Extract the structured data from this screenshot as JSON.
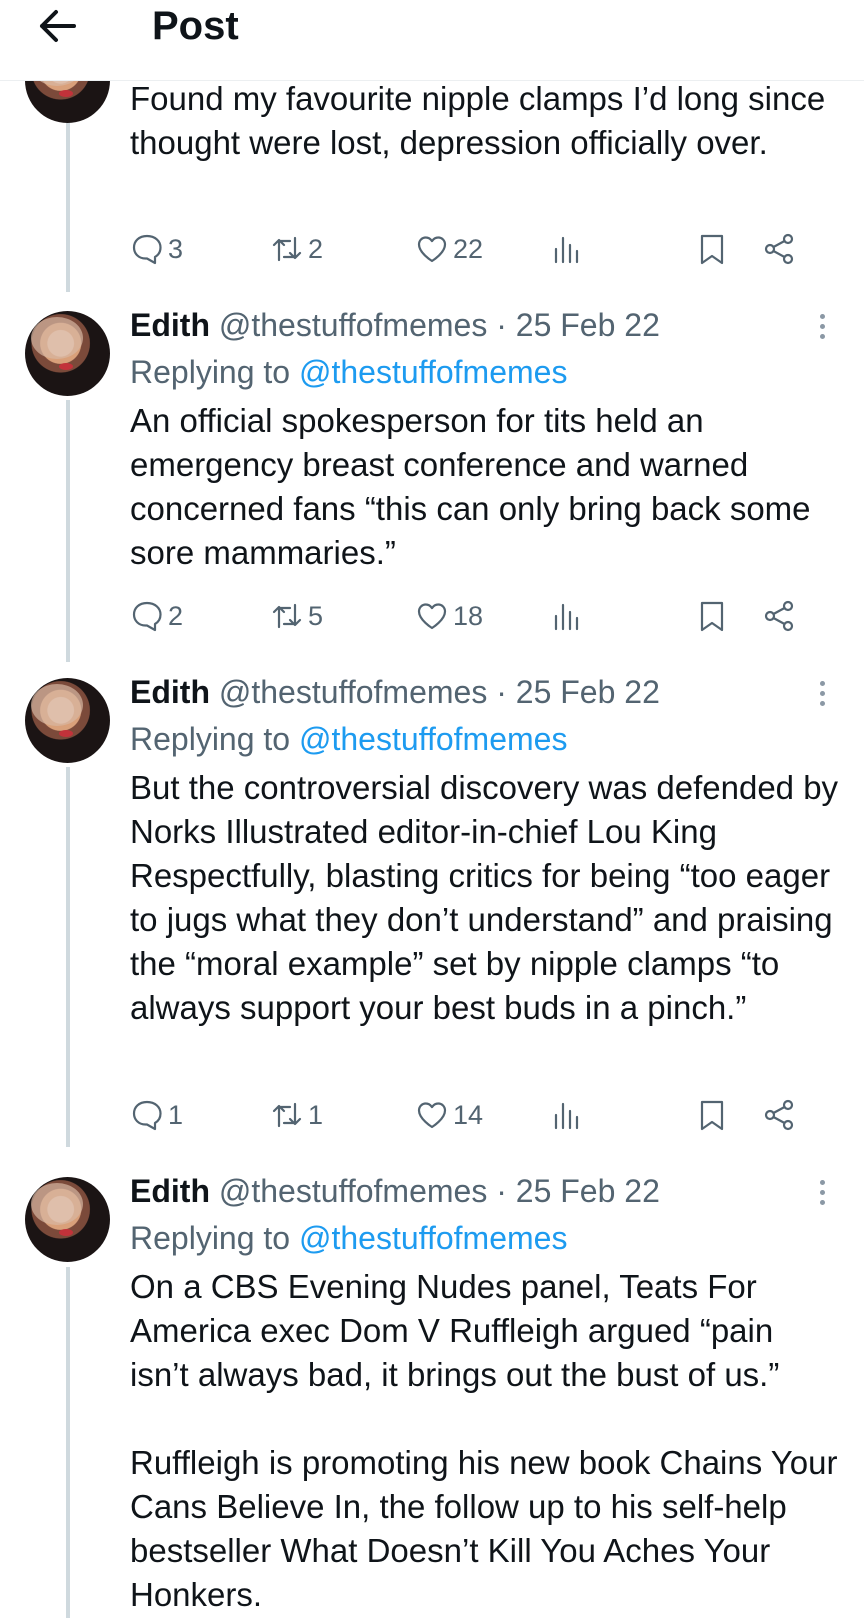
{
  "header": {
    "title": "Post",
    "back_icon": "arrow-left-icon"
  },
  "tweets": [
    {
      "text": "Found my favourite nipple clamps I’d long since thought were lost, depression officially over.",
      "replies": "3",
      "reposts": "2",
      "likes": "22"
    },
    {
      "name": "Edith",
      "handle": "@thestuffofmemes",
      "sep": "·",
      "date": "25 Feb 22",
      "replying_prefix": "Replying to",
      "replying_to": "@thestuffofmemes",
      "text": "An official spokesperson for tits held an emergency breast conference and warned concerned fans “this can only bring back some sore mammaries.”",
      "replies": "2",
      "reposts": "5",
      "likes": "18"
    },
    {
      "name": "Edith",
      "handle": "@thestuffofmemes",
      "sep": "·",
      "date": "25 Feb 22",
      "replying_prefix": "Replying to",
      "replying_to": "@thestuffofmemes",
      "text": "But the controversial discovery was defended by Norks Illustrated editor-in-chief Lou King Respectfully, blasting critics for being “too eager to jugs what they don’t understand” and praising the “moral example” set by nipple clamps “to always support your best buds in a pinch.”",
      "replies": "1",
      "reposts": "1",
      "likes": "14"
    },
    {
      "name": "Edith",
      "handle": "@thestuffofmemes",
      "sep": "·",
      "date": "25 Feb 22",
      "replying_prefix": "Replying to",
      "replying_to": "@thestuffofmemes",
      "text": "On a CBS Evening Nudes panel, Teats For America exec Dom V Ruffleigh argued “pain isn’t always bad, it brings out the bust of us.”\n\nRuffleigh is promoting his new book Chains Your Cans Believe In, the follow up to his self-help bestseller What Doesn’t Kill You Aches Your Honkers."
    }
  ],
  "colors": {
    "link": "#1d9bf0",
    "muted": "#536471",
    "thread_line": "#cfd9de"
  }
}
